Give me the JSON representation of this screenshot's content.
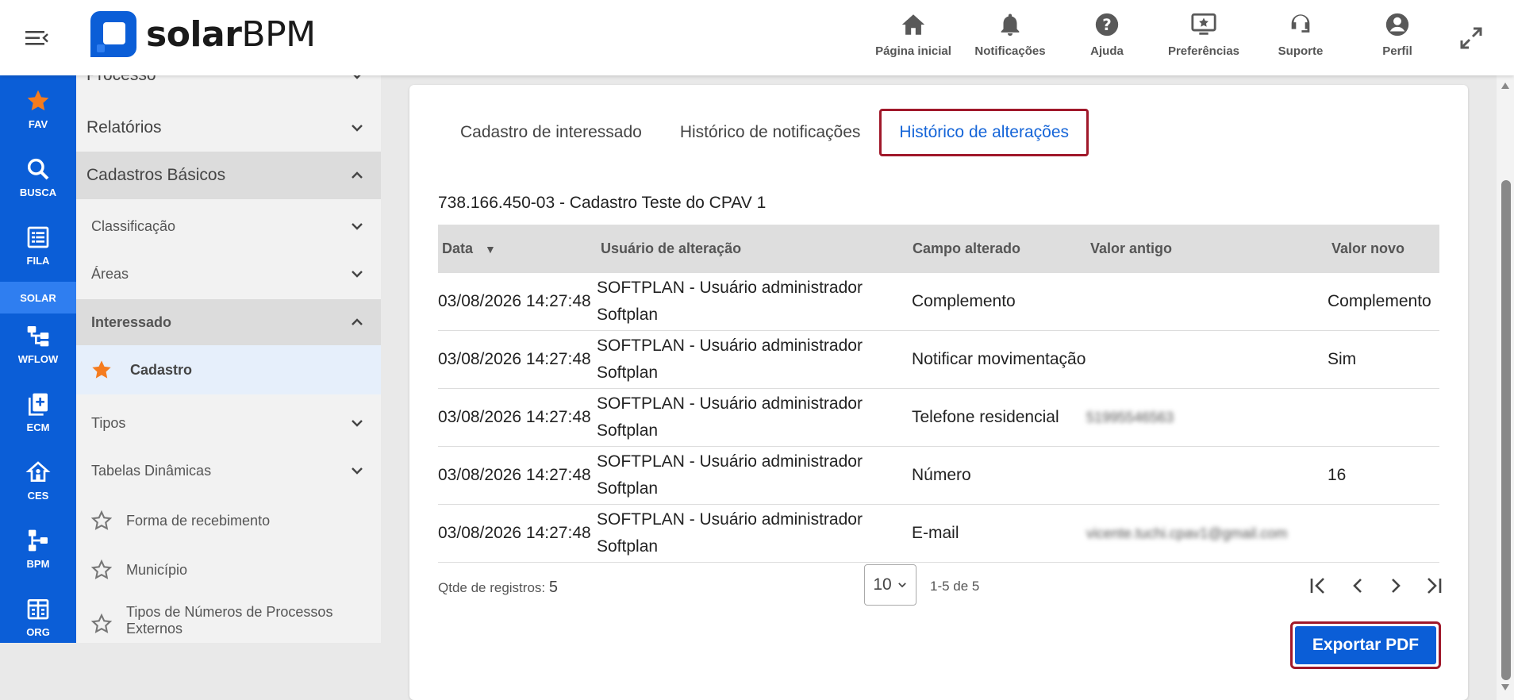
{
  "app": {
    "logo_bold": "solar",
    "logo_light": "BPM"
  },
  "top_actions": [
    {
      "label": "Página inicial",
      "icon": "home-icon"
    },
    {
      "label": "Notificações",
      "icon": "bell-icon"
    },
    {
      "label": "Ajuda",
      "icon": "help-icon"
    },
    {
      "label": "Preferências",
      "icon": "preferences-icon"
    },
    {
      "label": "Suporte",
      "icon": "support-icon"
    },
    {
      "label": "Perfil",
      "icon": "profile-icon"
    }
  ],
  "rail": {
    "fav": "FAV",
    "busca": "BUSCA",
    "fila": "FILA",
    "solar": "SOLAR",
    "wflow": "WFLOW",
    "ecm": "ECM",
    "ces": "CES",
    "bpm": "BPM",
    "org": "ORG"
  },
  "sidebar": {
    "processo": "Processo",
    "relatorios": "Relatórios",
    "cadastros_basicos": "Cadastros Básicos",
    "classificacao": "Classificação",
    "areas": "Áreas",
    "interessado": "Interessado",
    "cadastro": "Cadastro",
    "tipos": "Tipos",
    "tabelas_dinamicas": "Tabelas Dinâmicas",
    "forma_recebimento": "Forma de recebimento",
    "municipio": "Município",
    "tipos_numeros": "Tipos de Números de Processos Externos"
  },
  "tabs": {
    "cadastro": "Cadastro de interessado",
    "notificacoes": "Histórico de notificações",
    "alteracoes": "Histórico de alterações"
  },
  "record_title": "738.166.450-03 - Cadastro Teste do CPAV 1",
  "table": {
    "headers": {
      "data": "Data",
      "sort": "▼",
      "usuario": "Usuário de alteração",
      "campo": "Campo alterado",
      "antigo": "Valor antigo",
      "novo": "Valor novo"
    },
    "rows": [
      {
        "data": "03/08/2026 14:27:48",
        "usuario1": "SOFTPLAN - Usuário administrador",
        "usuario2": "Softplan",
        "campo": "Complemento",
        "antigo": "",
        "novo": "Complemento"
      },
      {
        "data": "03/08/2026 14:27:48",
        "usuario1": "SOFTPLAN - Usuário administrador",
        "usuario2": "Softplan",
        "campo": "Notificar movimentação",
        "antigo": "",
        "novo": "Sim"
      },
      {
        "data": "03/08/2026 14:27:48",
        "usuario1": "SOFTPLAN - Usuário administrador",
        "usuario2": "Softplan",
        "campo": "Telefone residencial",
        "antigo": "51995546563",
        "novo": ""
      },
      {
        "data": "03/08/2026 14:27:48",
        "usuario1": "SOFTPLAN - Usuário administrador",
        "usuario2": "Softplan",
        "campo": "Número",
        "antigo": "",
        "novo": "16"
      },
      {
        "data": "03/08/2026 14:27:48",
        "usuario1": "SOFTPLAN - Usuário administrador",
        "usuario2": "Softplan",
        "campo": "E-mail",
        "antigo": "vicente.tuchi.cpav1@gmail.com",
        "novo": ""
      }
    ]
  },
  "pager": {
    "qtde_label": "Qtde de registros:",
    "qtde_value": "5",
    "page_size": "10",
    "range": "1-5 de 5"
  },
  "export_label": "Exportar PDF",
  "colors": {
    "primary": "#0b5ed7",
    "highlight_border": "#a0182a",
    "active_tab": "#1565d8",
    "star": "#f57c1f"
  }
}
